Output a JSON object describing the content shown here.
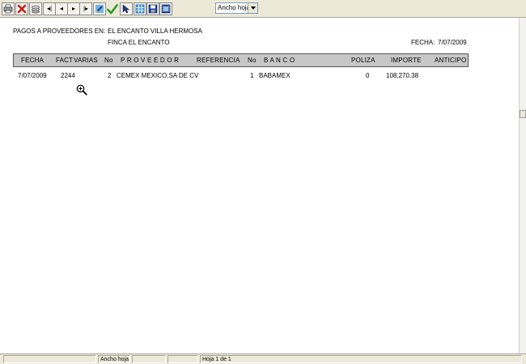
{
  "toolbar": {
    "buttons": [
      {
        "name": "print-button",
        "icon": "printer-icon"
      },
      {
        "name": "close-button",
        "icon": "red-x-icon"
      },
      {
        "name": "export-button",
        "icon": "disk-stack-icon"
      },
      {
        "name": "first-page-button",
        "icon": "first-page-icon",
        "glyph": "◂|"
      },
      {
        "name": "previous-page-button",
        "icon": "previous-page-icon",
        "glyph": "◂"
      },
      {
        "name": "next-page-button",
        "icon": "next-page-icon",
        "glyph": "▸"
      },
      {
        "name": "last-page-button",
        "icon": "last-page-icon",
        "glyph": "|▸"
      },
      {
        "name": "edit-button",
        "icon": "pencil-icon"
      },
      {
        "name": "confirm-button",
        "icon": "green-check-icon"
      },
      {
        "name": "pointer-button",
        "icon": "arrow-pointer-icon"
      },
      {
        "name": "grid-button",
        "icon": "grid-icon"
      },
      {
        "name": "save-button",
        "icon": "floppy-icon"
      },
      {
        "name": "film-button",
        "icon": "film-icon"
      }
    ],
    "zoom_value": "Ancho hoja"
  },
  "report": {
    "label_payments": "PAGOS A PROVEEDORES EN:",
    "company": "EL ENCANTO VILLA HERMOSA",
    "farm": "FINCA EL ENCANTO",
    "date_label": "FECHA:",
    "date_value": "7/07/2009",
    "columns": [
      "FECHA",
      "FACT",
      "VARIAS",
      "No",
      "P R O V E E D O R",
      "REFERENCIA",
      "No",
      "B A N C O",
      "POLIZA",
      "IMPORTE",
      "ANTICIPO"
    ],
    "rows": [
      {
        "fecha": "7/07/2009",
        "fact": "2244",
        "varias": "",
        "no": "2",
        "proveedor": "CEMEX MEXICO,SA DE CV",
        "referencia": "",
        "no_banco": "1",
        "banco": "BABAMEX",
        "poliza": "0",
        "importe": "108,270.38",
        "anticipo": ""
      }
    ]
  },
  "statusbar": {
    "panels": [
      "",
      "",
      "Ancho hoja",
      "",
      "",
      "Hoja 1 de 1"
    ]
  },
  "colors": {
    "toolbar_bg": "#ece9d8",
    "header_bar": "#c7c7c7",
    "check_green": "#2e9a2e",
    "close_red": "#c0201a"
  }
}
